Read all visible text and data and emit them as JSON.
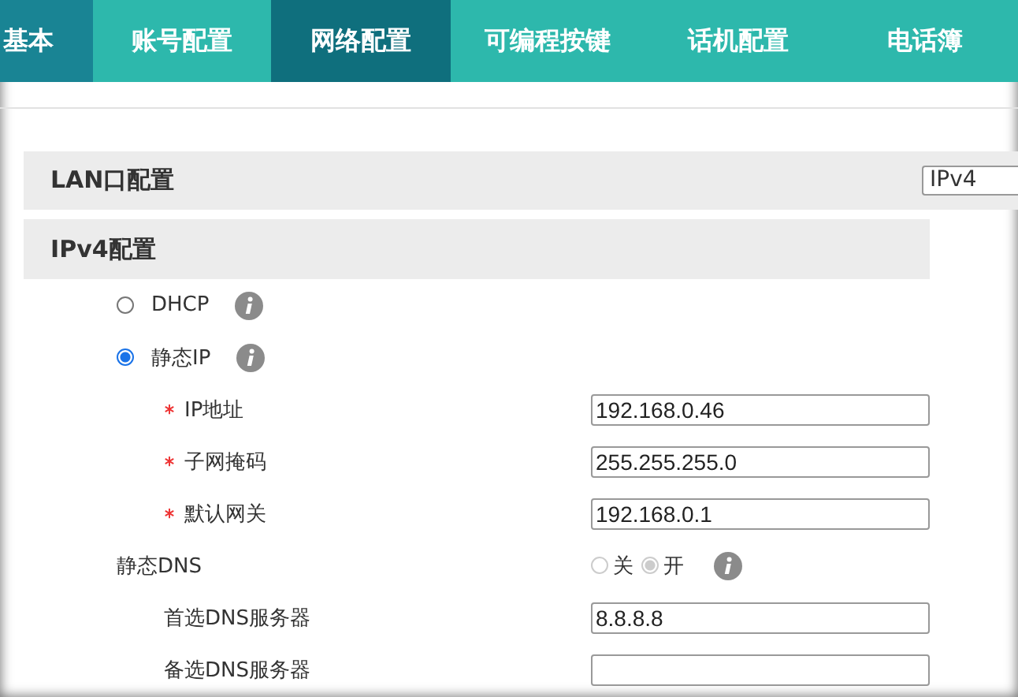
{
  "tabs": [
    {
      "label": "基本",
      "selected": false,
      "highlighted": true
    },
    {
      "label": "账号配置",
      "selected": false,
      "highlighted": false
    },
    {
      "label": "网络配置",
      "selected": true,
      "highlighted": false
    },
    {
      "label": "可编程按键",
      "selected": false,
      "highlighted": false
    },
    {
      "label": "话机配置",
      "selected": false,
      "highlighted": false
    },
    {
      "label": "电话簿",
      "selected": false,
      "highlighted": false
    }
  ],
  "lan": {
    "title": "LAN口配置",
    "select_value": "IPv4"
  },
  "ipv4": {
    "title": "IPv4配置",
    "modes": [
      {
        "label": "DHCP",
        "selected": false
      },
      {
        "label": "静态IP",
        "selected": true
      }
    ],
    "fields": [
      {
        "label": "IP地址",
        "required": true,
        "value": "192.168.0.46"
      },
      {
        "label": "子网掩码",
        "required": true,
        "value": "255.255.255.0"
      },
      {
        "label": "默认网关",
        "required": true,
        "value": "192.168.0.1"
      }
    ],
    "static_dns": {
      "label": "静态DNS",
      "options": [
        {
          "label": "关",
          "selected": false
        },
        {
          "label": "开",
          "selected": true
        }
      ],
      "disabled": true
    },
    "dns_fields": [
      {
        "label": "首选DNS服务器",
        "value": "8.8.8.8"
      },
      {
        "label": "备选DNS服务器"
      }
    ]
  }
}
